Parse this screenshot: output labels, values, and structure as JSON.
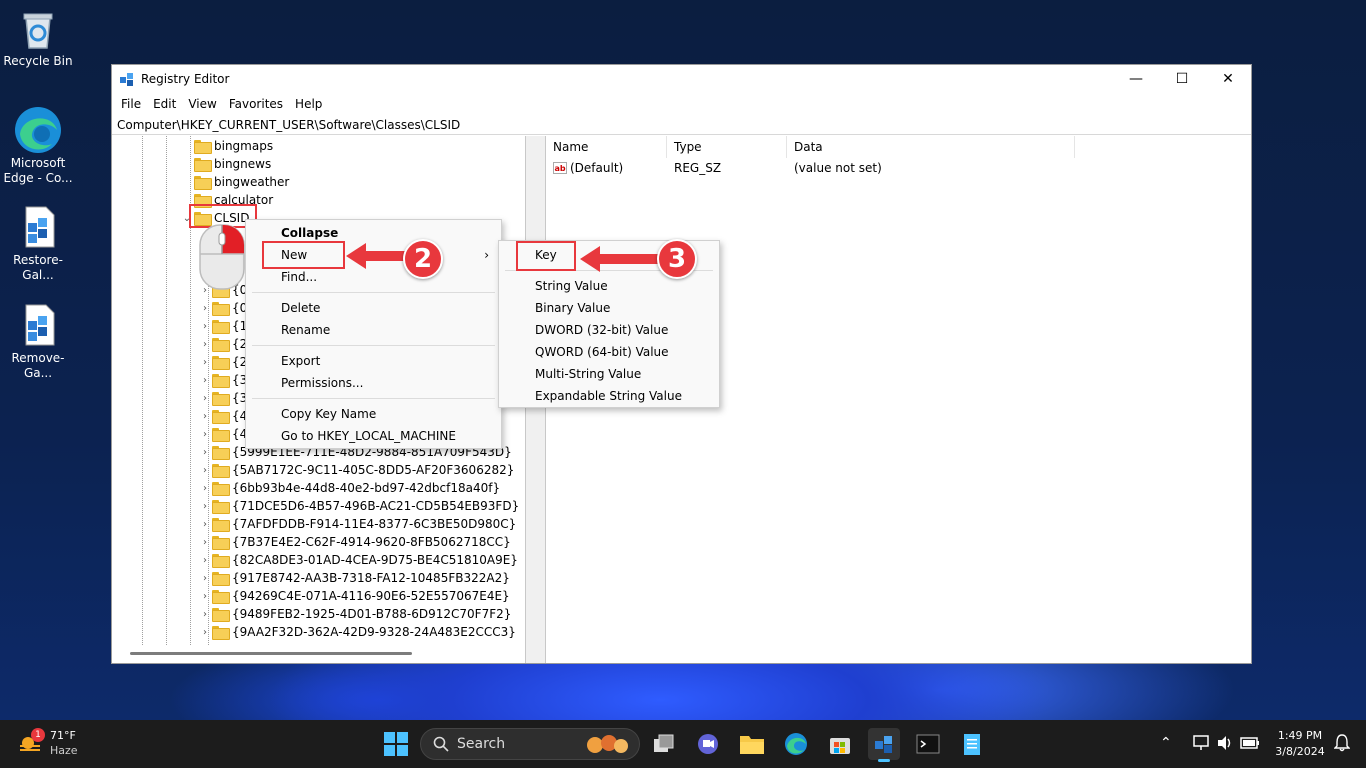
{
  "desktop": {
    "icons": [
      {
        "label": "Recycle Bin",
        "icon": "recycle-bin-icon"
      },
      {
        "label": "Microsoft Edge - Co...",
        "icon": "edge-icon"
      },
      {
        "label": "Restore-Gal...",
        "icon": "registry-file-icon"
      },
      {
        "label": "Remove-Ga...",
        "icon": "registry-file-icon"
      }
    ]
  },
  "window": {
    "title": "Registry Editor",
    "controls": {
      "minimize": "—",
      "maximize": "☐",
      "close": "✕"
    },
    "menu": [
      "File",
      "Edit",
      "View",
      "Favorites",
      "Help"
    ],
    "address": "Computer\\HKEY_CURRENT_USER\\Software\\Classes\\CLSID"
  },
  "tree": {
    "top_items": [
      "bingmaps",
      "bingnews",
      "bingweather",
      "calculator",
      "CLSID"
    ],
    "hidden_children": [
      "{0",
      "{1",
      "{2",
      "{2",
      "{3",
      "{3",
      "{4",
      "{4"
    ],
    "guid_items": [
      "{5999E1EE-711E-48D2-9884-851A709F543D}",
      "{5AB7172C-9C11-405C-8DD5-AF20F3606282}",
      "{6bb93b4e-44d8-40e2-bd97-42dbcf18a40f}",
      "{71DCE5D6-4B57-496B-AC21-CD5B54EB93FD}",
      "{7AFDFDDB-F914-11E4-8377-6C3BE50D980C}",
      "{7B37E4E2-C62F-4914-9620-8FB5062718CC}",
      "{82CA8DE3-01AD-4CEA-9D75-BE4C51810A9E}",
      "{917E8742-AA3B-7318-FA12-10485FB322A2}",
      "{94269C4E-071A-4116-90E6-52E557067E4E}",
      "{9489FEB2-1925-4D01-B788-6D912C70F7F2}",
      "{9AA2F32D-362A-42D9-9328-24A483E2CCC3}"
    ]
  },
  "values": {
    "headers": {
      "name": "Name",
      "type": "Type",
      "data": "Data"
    },
    "rows": [
      {
        "name": "(Default)",
        "type": "REG_SZ",
        "data": "(value not set)"
      }
    ]
  },
  "context_menu": {
    "items": [
      "Collapse",
      "New",
      "Find...",
      "Delete",
      "Rename",
      "Export",
      "Permissions...",
      "Copy Key Name",
      "Go to HKEY_LOCAL_MACHINE"
    ],
    "submenu_arrow": "›"
  },
  "submenu": {
    "items": [
      "Key",
      "String Value",
      "Binary Value",
      "DWORD (32-bit) Value",
      "QWORD (64-bit) Value",
      "Multi-String Value",
      "Expandable String Value"
    ]
  },
  "annotations": {
    "step2": "2",
    "step3": "3"
  },
  "colors": {
    "highlight": "#e8383d",
    "folder": "#f7cf57"
  },
  "taskbar": {
    "weather": {
      "temp": "71°F",
      "condition": "Haze",
      "badge": "1"
    },
    "search_label": "Search",
    "clock": {
      "time": "1:49 PM",
      "date": "3/8/2024"
    }
  }
}
